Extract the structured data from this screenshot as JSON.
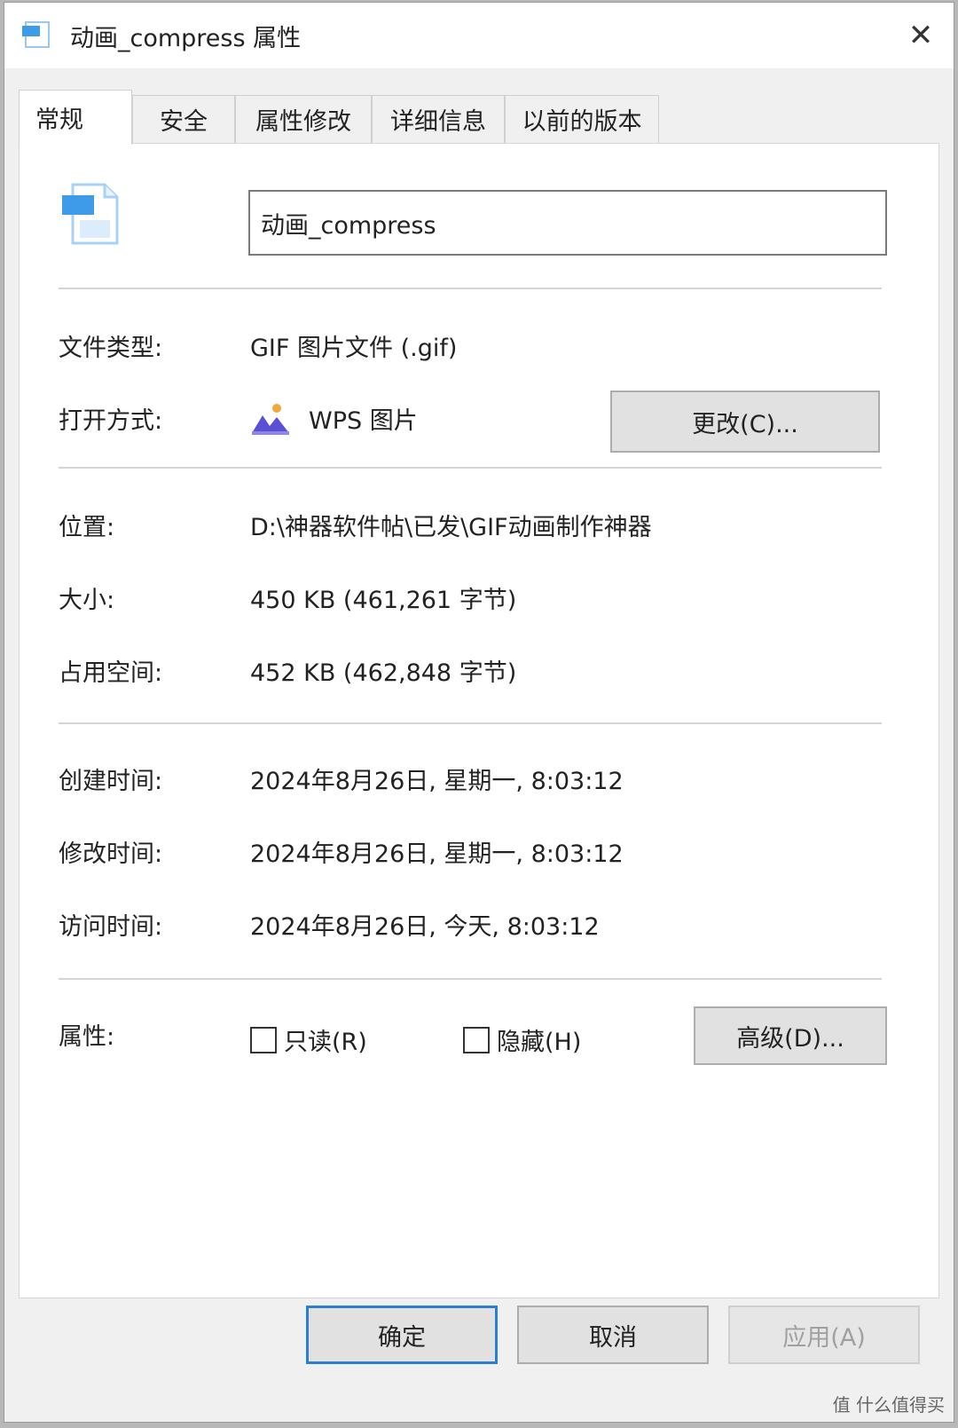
{
  "window": {
    "title": "动画_compress 属性",
    "close_glyph": "✕"
  },
  "tabs": [
    {
      "label": "常规",
      "active": true
    },
    {
      "label": "安全",
      "active": false
    },
    {
      "label": "属性修改",
      "active": false
    },
    {
      "label": "详细信息",
      "active": false
    },
    {
      "label": "以前的版本",
      "active": false
    }
  ],
  "general": {
    "file_name": "动画_compress",
    "file_type_label": "文件类型:",
    "file_type_value": "GIF 图片文件 (.gif)",
    "open_with_label": "打开方式:",
    "open_with_app": "WPS 图片",
    "change_button": "更改(C)...",
    "location_label": "位置:",
    "location_value": "D:\\神器软件帖\\已发\\GIF动画制作神器",
    "size_label": "大小:",
    "size_value": "450 KB (461,261 字节)",
    "size_on_disk_label": "占用空间:",
    "size_on_disk_value": "452 KB (462,848 字节)",
    "created_label": "创建时间:",
    "created_value": "2024年8月26日, 星期一, 8:03:12",
    "modified_label": "修改时间:",
    "modified_value": "2024年8月26日, 星期一, 8:03:12",
    "accessed_label": "访问时间:",
    "accessed_value": "2024年8月26日, 今天, 8:03:12",
    "attributes_label": "属性:",
    "readonly_label": "只读(R)",
    "readonly_checked": false,
    "hidden_label": "隐藏(H)",
    "hidden_checked": false,
    "advanced_button": "高级(D)..."
  },
  "footer": {
    "ok": "确定",
    "cancel": "取消",
    "apply": "应用(A)"
  },
  "watermark": "值 什么值得买",
  "colors": {
    "default_button_border": "#2a7fd4",
    "icon_blue": "#3d9be9"
  }
}
